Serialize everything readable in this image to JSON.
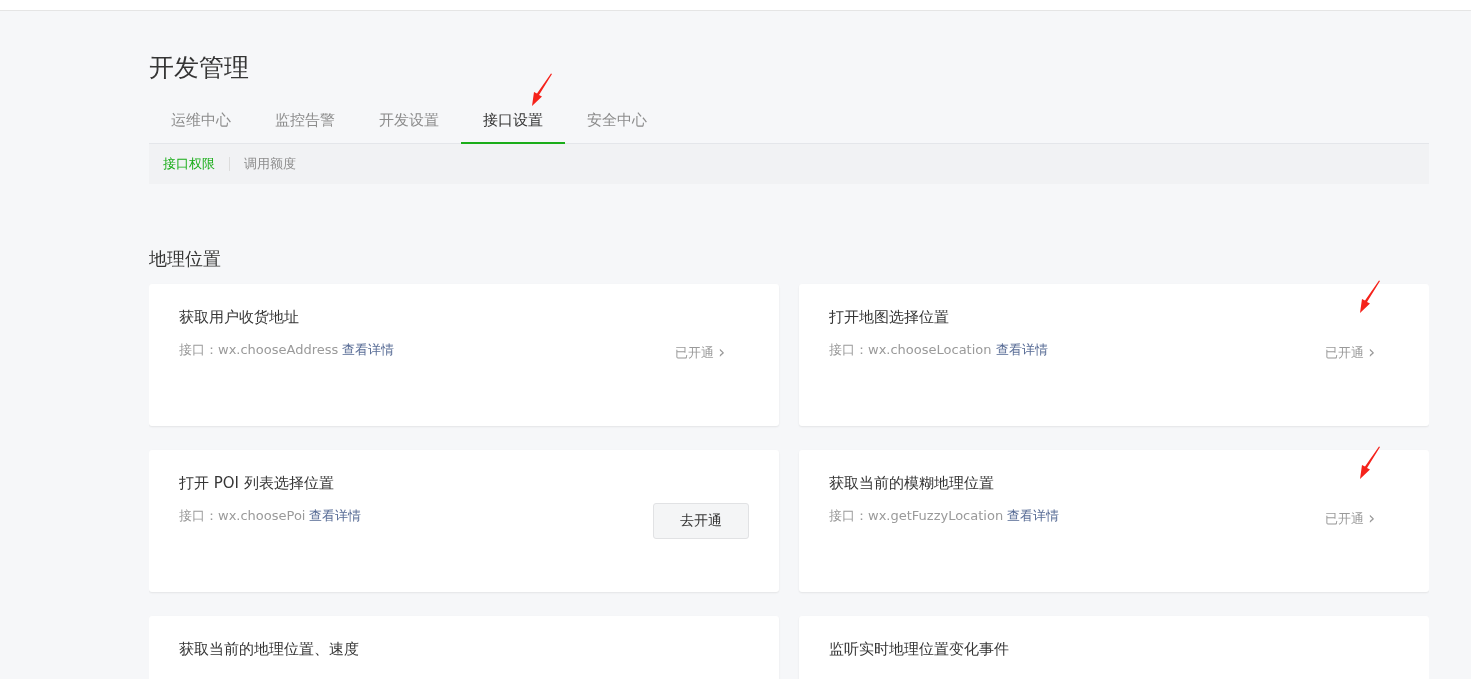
{
  "page_title": "开发管理",
  "tabs": [
    {
      "label": "运维中心",
      "selected": false,
      "marked": false
    },
    {
      "label": "监控告警",
      "selected": false,
      "marked": false
    },
    {
      "label": "开发设置",
      "selected": false,
      "marked": false
    },
    {
      "label": "接口设置",
      "selected": true,
      "marked": true
    },
    {
      "label": "安全中心",
      "selected": false,
      "marked": false
    }
  ],
  "subtabs": [
    {
      "label": "接口权限",
      "selected": true
    },
    {
      "label": "调用额度",
      "selected": false
    }
  ],
  "section_title": "地理位置",
  "apis": [
    {
      "title": "获取用户收货地址",
      "interface": "接口：wx.chooseAddress",
      "link": "查看详情",
      "status": {
        "kind": "enabled",
        "label": "已开通",
        "chevron": "›"
      },
      "marked": false
    },
    {
      "title": "打开地图选择位置",
      "interface": "接口：wx.chooseLocation",
      "link": "查看详情",
      "status": {
        "kind": "enabled",
        "label": "已开通",
        "chevron": "›"
      },
      "marked": true
    },
    {
      "title": "打开 POI 列表选择位置",
      "interface": "接口：wx.choosePoi",
      "link": "查看详情",
      "status": {
        "kind": "button",
        "label": "去开通"
      },
      "marked": false
    },
    {
      "title": "获取当前的模糊地理位置",
      "interface": "接口：wx.getFuzzyLocation",
      "link": "查看详情",
      "status": {
        "kind": "enabled",
        "label": "已开通",
        "chevron": "›"
      },
      "marked": true
    },
    {
      "title": "获取当前的地理位置、速度",
      "marked": false
    },
    {
      "title": "监听实时地理位置变化事件",
      "marked": false
    }
  ]
}
